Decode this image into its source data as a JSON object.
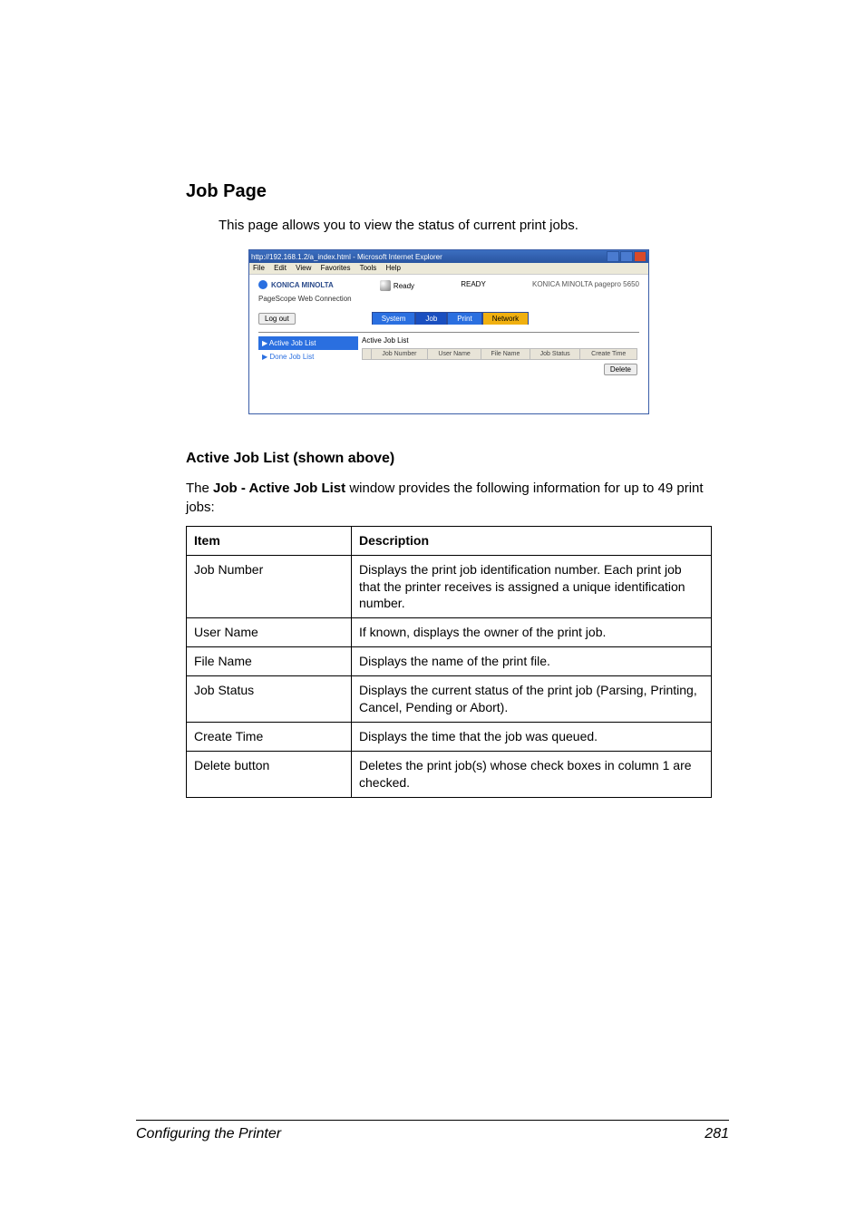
{
  "heading": "Job Page",
  "intro": "This page allows you to view the status of current print jobs.",
  "screenshot": {
    "window_title": "http://192.168.1.2/a_index.html - Microsoft Internet Explorer",
    "menu": [
      "File",
      "Edit",
      "View",
      "Favorites",
      "Tools",
      "Help"
    ],
    "brand": "KONICA MINOLTA",
    "connection": "PageScope Web Connection",
    "ready_label": "Ready",
    "ready_status": "READY",
    "model": "KONICA MINOLTA pagepro 5650",
    "logout": "Log out",
    "tabs": {
      "system": "System",
      "job": "Job",
      "print": "Print",
      "network": "Network"
    },
    "side": {
      "active": "▶ Active Job List",
      "done": "▶ Done Job List"
    },
    "panel_title": "Active Job List",
    "cols": [
      "",
      "Job Number",
      "User Name",
      "File Name",
      "Job Status",
      "Create Time"
    ],
    "delete": "Delete"
  },
  "subheading": "Active Job List (shown above)",
  "para_prefix": "The ",
  "para_bold": "Job - Active Job List",
  "para_suffix": " window provides the following information for up to 49 print jobs:",
  "table": {
    "head": {
      "item": "Item",
      "desc": "Description"
    },
    "rows": [
      {
        "item": "Job Number",
        "desc": "Displays the print job identification number. Each print job that the printer receives is assigned a unique identification number."
      },
      {
        "item": "User Name",
        "desc": "If known, displays the owner of the print job."
      },
      {
        "item": "File Name",
        "desc": "Displays the name of the print file."
      },
      {
        "item": "Job Status",
        "desc": "Displays the current status of the print job (Parsing, Printing, Cancel, Pending or Abort)."
      },
      {
        "item": "Create Time",
        "desc": "Displays the time that the job was queued."
      },
      {
        "item": "Delete button",
        "desc": "Deletes the print job(s) whose check boxes in column 1 are checked."
      }
    ]
  },
  "footer": {
    "title": "Configuring the Printer",
    "page": "281"
  }
}
